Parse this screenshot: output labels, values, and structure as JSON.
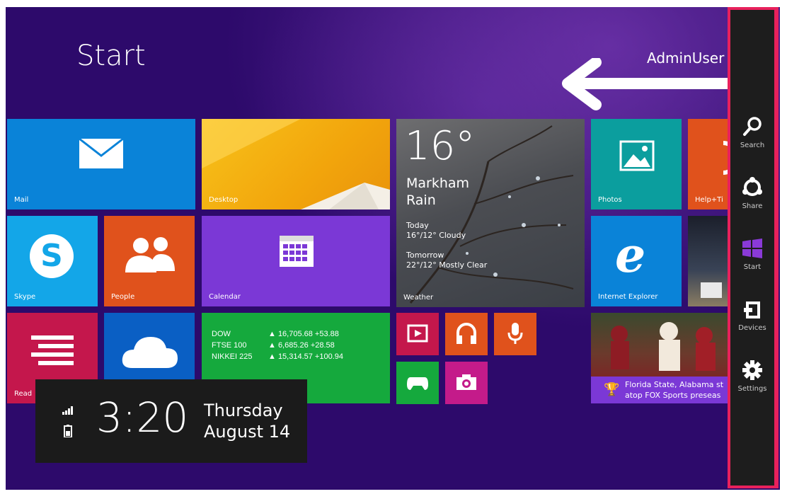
{
  "screen": {
    "title": "Start",
    "user": "AdminUser"
  },
  "tiles": {
    "mail": "Mail",
    "desktop": "Desktop",
    "weather": {
      "temp": "16°",
      "city": "Markham",
      "condition": "Rain",
      "today_label": "Today",
      "today_forecast": "16°/12° Cloudy",
      "tomorrow_label": "Tomorrow",
      "tomorrow_forecast": "22°/12° Mostly Clear",
      "label": "Weather"
    },
    "photos": "Photos",
    "help": "Help+Ti",
    "skype": "Skype",
    "people": "People",
    "calendar": "Calendar",
    "ie": "Internet Explorer",
    "reading": "Read",
    "finance": [
      {
        "name": "DOW",
        "value": "▲ 16,705.68 +53.88"
      },
      {
        "name": "FTSE 100",
        "value": "▲ 6,685.26 +28.58"
      },
      {
        "name": "NIKKEI 225",
        "value": "▲ 15,314.57 +100.94"
      }
    ],
    "sports": {
      "line1": "Florida State, Alabama st",
      "line2": "atop FOX Sports preseas"
    }
  },
  "charms": {
    "search": "Search",
    "share": "Share",
    "start": "Start",
    "devices": "Devices",
    "settings": "Settings"
  },
  "clock": {
    "time": "3:20",
    "day": "Thursday",
    "date": "August 14"
  },
  "colors": {
    "background": "#2d0a6b",
    "mail": "#0a83d8",
    "desktop": "#f2b20d",
    "skype": "#13a6e8",
    "people": "#e0521c",
    "calendar": "#7b38d6",
    "reading": "#c4174c",
    "onedrive": "#0a5fc4",
    "finance": "#15a93d",
    "charm_border": "#e8215c"
  }
}
